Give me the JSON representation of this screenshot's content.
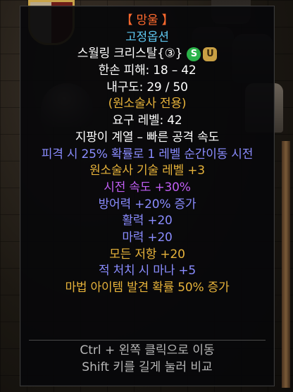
{
  "item": {
    "name": "【 망울 】",
    "quality": "고정옵션",
    "base_type": "스월링 크리스탈{③}",
    "socket_badges": {
      "left": "S",
      "right": "U"
    },
    "one_hand_damage": "한손 피해: 18 – 42",
    "durability": "내구도: 29 / 50",
    "class_restriction": "(원소술사 전용)",
    "level_requirement": "요구 레벨: 42",
    "weapon_class": "지팡이 계열 – 빠른 공격 속도",
    "properties": [
      {
        "text": "피격 시 25% 확률로 1 레벨 순간이동 시전",
        "tone": "blue"
      },
      {
        "text": "원소술사 기술 레벨 +3",
        "tone": "gold"
      },
      {
        "text": "시전 속도 +30%",
        "tone": "purple"
      },
      {
        "text": "방어력 +20% 증가",
        "tone": "blue"
      },
      {
        "text": "활력 +20",
        "tone": "blue"
      },
      {
        "text": "마력 +20",
        "tone": "blue"
      },
      {
        "text": "모든 저항 +20",
        "tone": "gold"
      },
      {
        "text": "적 처치 시 마나 +5",
        "tone": "blue"
      },
      {
        "text": "마법 아이템 발견 확률 50% 증가",
        "tone": "gold"
      }
    ]
  },
  "footer": {
    "hint_move": "Ctrl + 왼쪽 클릭으로 이동",
    "hint_compare": "Shift 키를 길게 눌러 비교"
  },
  "colors": {
    "name": "#ff6a2e",
    "quality": "#5fc8f2",
    "base": "#ffffff",
    "restriction": "#e6b23a",
    "blue_stat": "#8a8cff",
    "gold_stat": "#e6b23a",
    "purple_stat": "#c05ef4",
    "hint": "#b7b7b7"
  }
}
